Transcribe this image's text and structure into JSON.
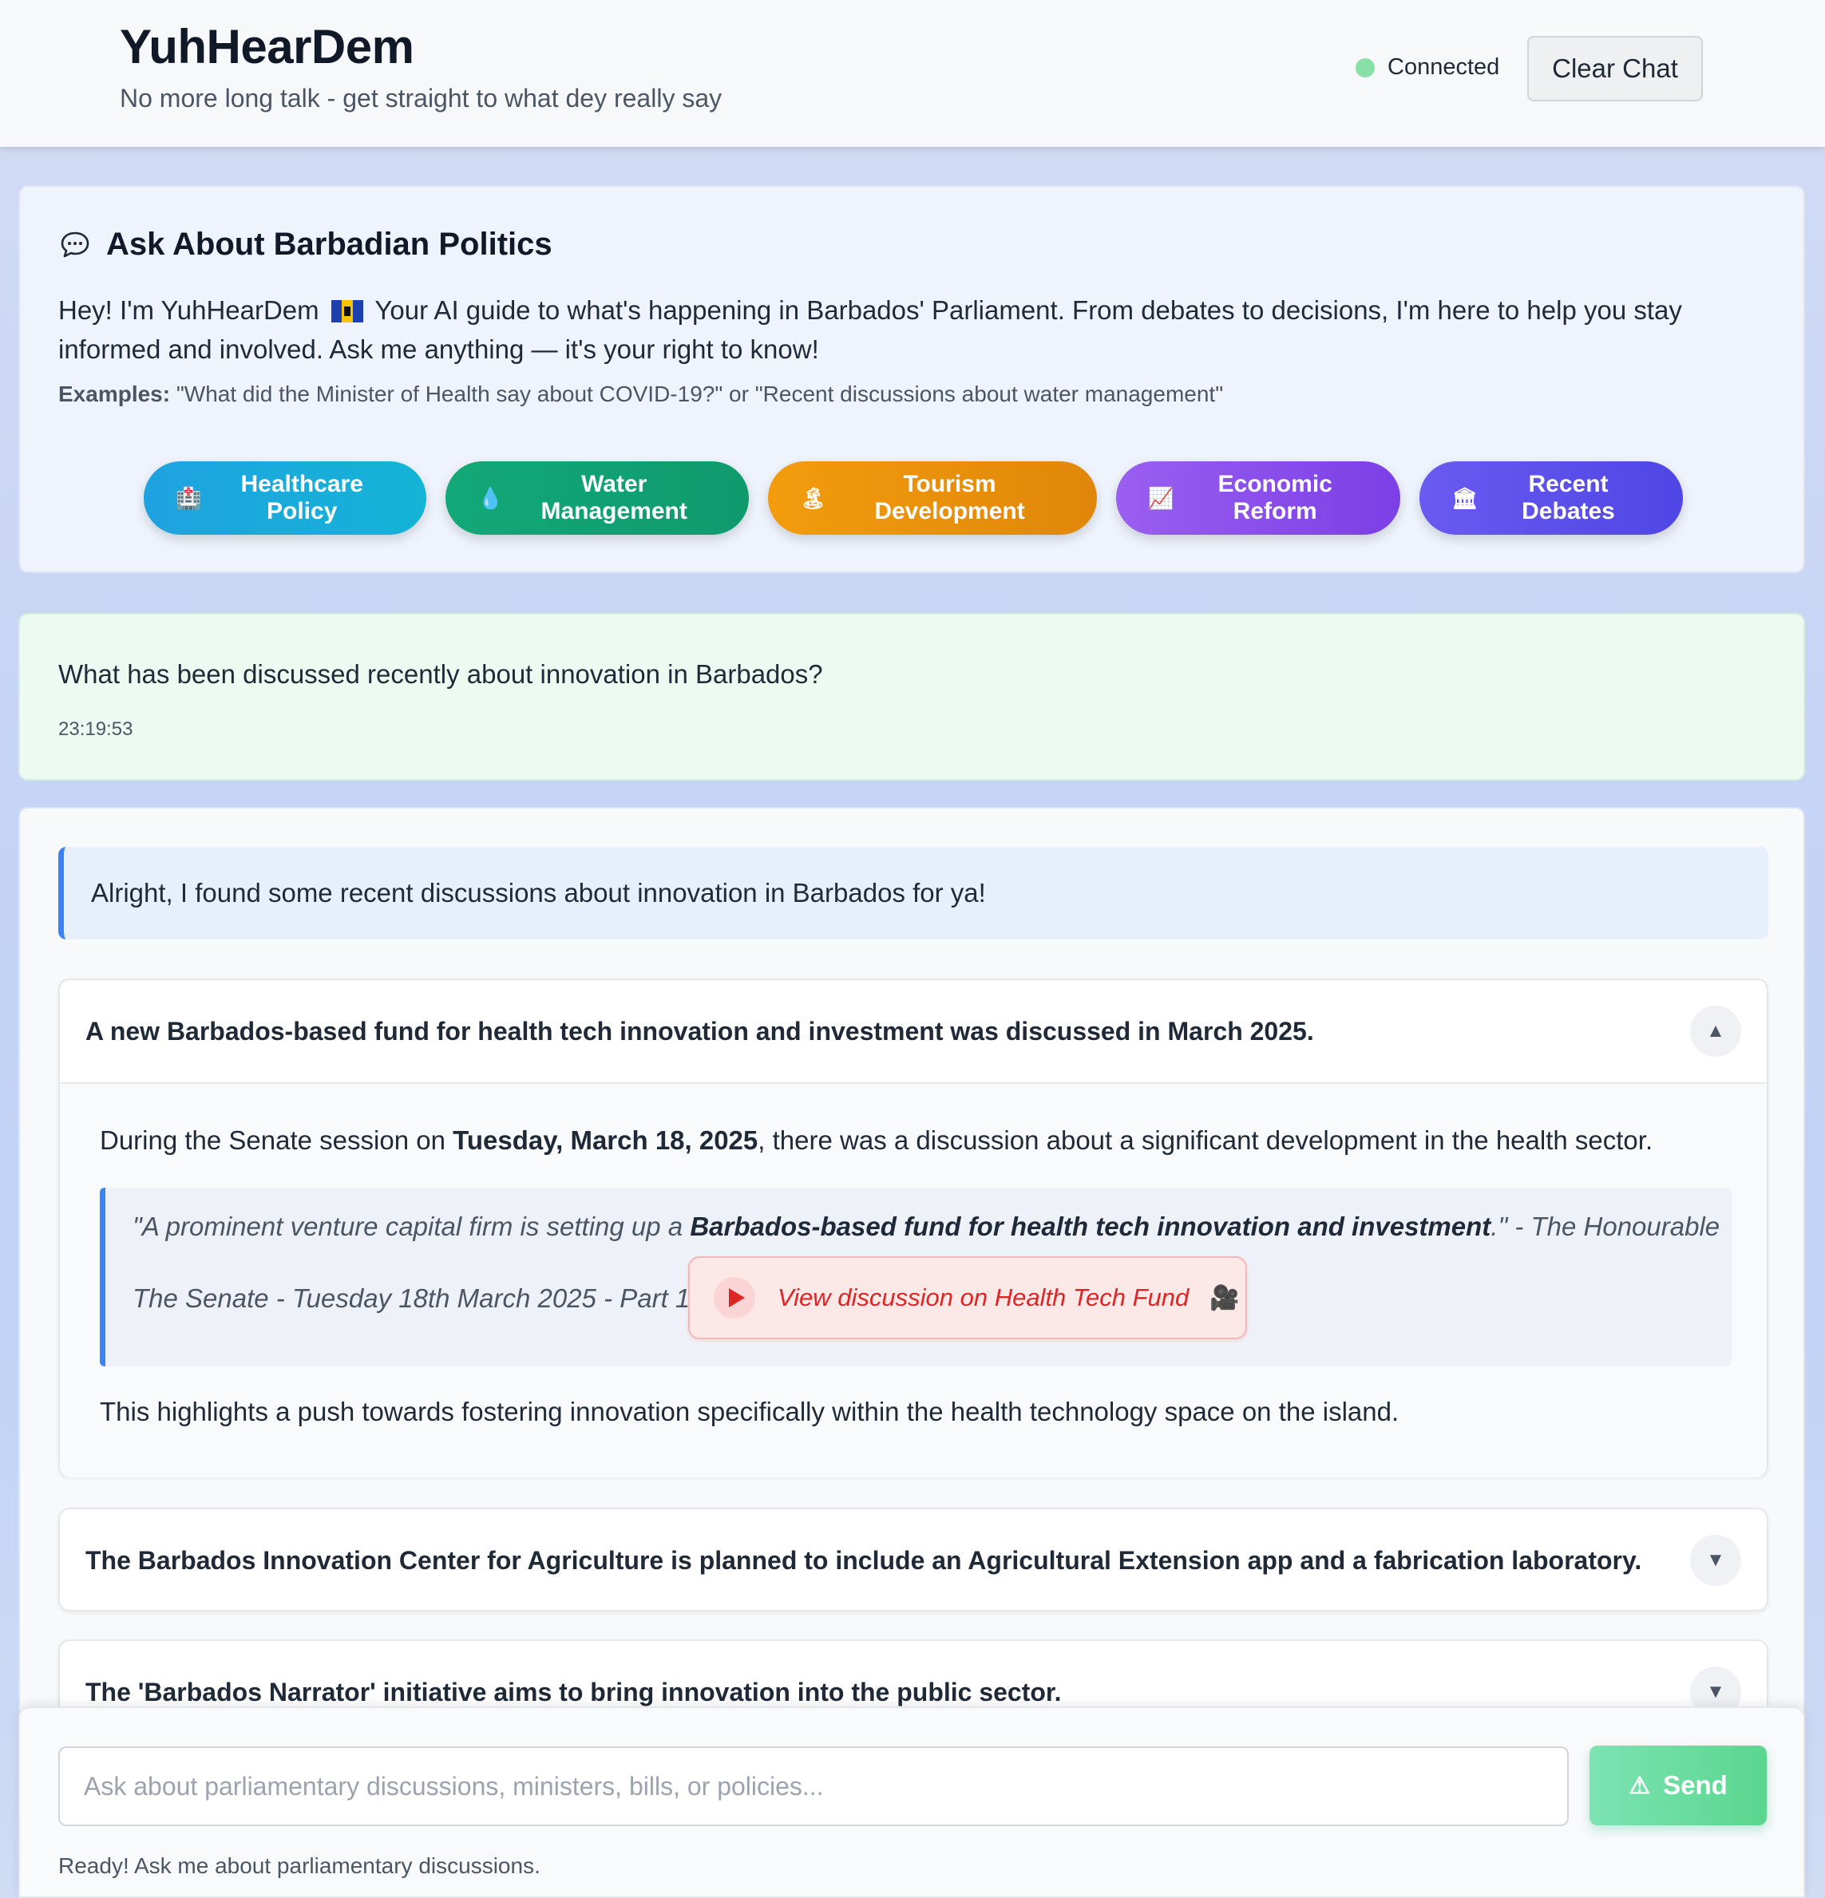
{
  "header": {
    "title": "YuhHearDem",
    "subtitle": "No more long talk - get straight to what dey really say",
    "status": "Connected",
    "clear_label": "Clear Chat"
  },
  "intro": {
    "title": "Ask About Barbadian Politics",
    "text_before_flag": "Hey! I'm YuhHearDem",
    "text_after_flag": "Your AI guide to what's happening in Barbados' Parliament. From debates to decisions, I'm here to help you stay informed and involved. Ask me anything — it's your right to know!",
    "examples_label": "Examples:",
    "examples_text": "\"What did the Minister of Health say about COVID-19?\" or \"Recent discussions about water management\"",
    "chips": [
      {
        "icon": "🏥",
        "label": "Healthcare Policy"
      },
      {
        "icon": "💧",
        "label": "Water Management"
      },
      {
        "icon": "🏝",
        "label": "Tourism Development"
      },
      {
        "icon": "📈",
        "label": "Economic Reform"
      },
      {
        "icon": "🏛",
        "label": "Recent Debates"
      }
    ],
    "colors": {
      "healthcare": "#1fa2e0",
      "water": "#12a878",
      "tourism": "#f39c0d",
      "economic": "#9a5ff0",
      "debates": "#4f46e5"
    }
  },
  "user_message": {
    "text": "What has been discussed recently about innovation in Barbados?",
    "time": "23:19:53"
  },
  "response": {
    "intro": "Alright, I found some recent discussions about innovation in Barbados for ya!",
    "items": [
      {
        "title": "A new Barbados-based fund for health tech innovation and investment was discussed in March 2025.",
        "expanded": true,
        "toggle": "▲",
        "body_before": "During the Senate session on ",
        "body_bold": "Tuesday, March 18, 2025",
        "body_after": ", there was a discussion about a significant development in the health sector.",
        "quote_before": "\"A prominent venture capital firm is setting up a ",
        "quote_bold": "Barbados-based fund for health tech innovation and investment",
        "quote_after": ".\" - The Honourable",
        "quote_source": "The Senate - Tuesday 18th March 2025 - Part 1",
        "video_label": "View discussion on Health Tech Fund",
        "video_icon": "🎥",
        "conclusion": "This highlights a push towards fostering innovation specifically within the health technology space on the island."
      },
      {
        "title": "The Barbados Innovation Center for Agriculture is planned to include an Agricultural Extension app and a fabrication laboratory.",
        "expanded": false,
        "toggle": "▼"
      },
      {
        "title": "The 'Barbados Narrator' initiative aims to bring innovation into the public sector.",
        "expanded": false,
        "toggle": "▼"
      }
    ]
  },
  "composer": {
    "placeholder": "Ask about parliamentary discussions, ministers, bills, or policies...",
    "send_label": "Send",
    "send_icon": "⚠",
    "status": "Ready! Ask me about parliamentary discussions."
  }
}
